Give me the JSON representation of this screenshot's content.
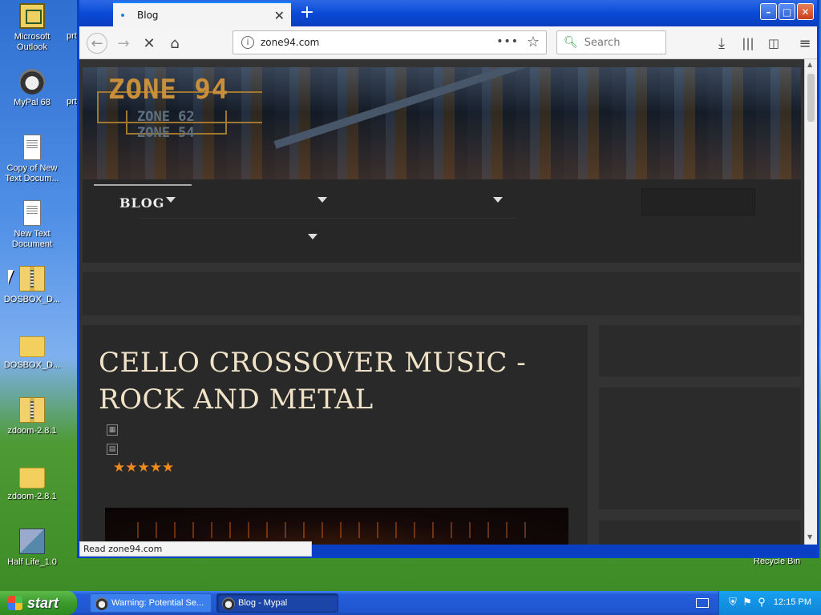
{
  "desktop": {
    "icons": [
      {
        "label": "Microsoft Outlook"
      },
      {
        "label": "MyPal 68"
      },
      {
        "label": "Copy of New Text Docum..."
      },
      {
        "label": "New Text Document"
      },
      {
        "label": "DOSBOX_D..."
      },
      {
        "label": "DOSBOX_D..."
      },
      {
        "label": "zdoom-2.8.1"
      },
      {
        "label": "zdoom-2.8.1"
      },
      {
        "label": "Half Life_1.0"
      }
    ],
    "cut_label_1": "prt",
    "cut_label_2": "prt",
    "recycle_bin": "Recycle Bin"
  },
  "browser": {
    "tab_title": "Blog",
    "url": "zone94.com",
    "search_placeholder": "Search",
    "status": "Read zone94.com",
    "page_actions": "•••"
  },
  "site": {
    "logo_main": "ZONE 94",
    "logo_sub_1": "ZONE 62",
    "logo_sub_2": "ZONE 54",
    "menu": {
      "blog_label": "BLOG"
    },
    "article": {
      "title": "CELLO CROSSOVER MUSIC - ROCK AND METAL",
      "rating": 5,
      "stars": "★★★★★"
    }
  },
  "taskbar": {
    "start_label": "start",
    "tasks": [
      {
        "label": "Warning: Potential Se..."
      },
      {
        "label": "Blog - Mypal"
      }
    ],
    "clock": "12:15 PM"
  }
}
